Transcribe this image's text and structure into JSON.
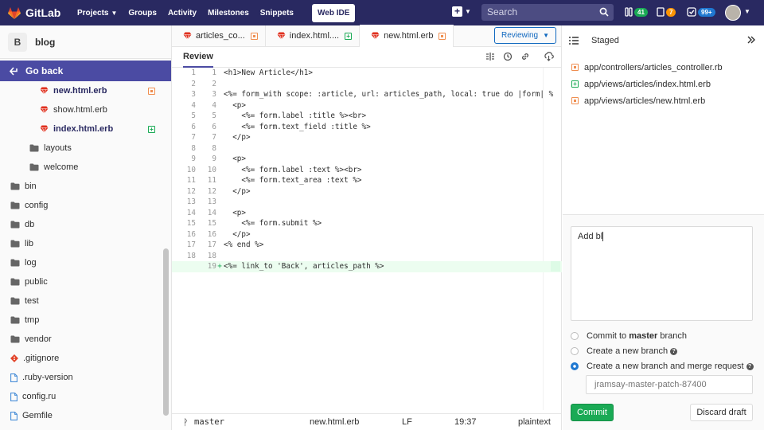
{
  "navbar": {
    "brand": "GitLab",
    "links": [
      {
        "label": "Projects",
        "dropdown": true
      },
      {
        "label": "Groups",
        "dropdown": false
      },
      {
        "label": "Activity",
        "dropdown": false
      },
      {
        "label": "Milestones",
        "dropdown": false
      },
      {
        "label": "Snippets",
        "dropdown": false
      }
    ],
    "web_ide": "Web IDE",
    "search_placeholder": "Search",
    "counters": {
      "merge_requests": "41",
      "issues": "7",
      "todos": "99+"
    },
    "colors": {
      "bg": "#292961",
      "mr_badge": "#1aaa55",
      "issue_badge": "#fc9403",
      "todo_badge": "#1f78d1"
    }
  },
  "sidebar": {
    "project_initial": "B",
    "project_name": "blog",
    "go_back": "Go back",
    "tree": [
      {
        "label": "new.html.erb",
        "type": "file-ruby",
        "indent": 3,
        "active": true,
        "status": "modified"
      },
      {
        "label": "show.html.erb",
        "type": "file-ruby",
        "indent": 3,
        "active": false,
        "status": ""
      },
      {
        "label": "index.html.erb",
        "type": "file-ruby",
        "indent": 3,
        "active": true,
        "status": "added"
      },
      {
        "label": "layouts",
        "type": "folder",
        "indent": 2,
        "active": false,
        "status": ""
      },
      {
        "label": "welcome",
        "type": "folder",
        "indent": 2,
        "active": false,
        "status": ""
      },
      {
        "label": "bin",
        "type": "folder",
        "indent": 0,
        "active": false,
        "status": ""
      },
      {
        "label": "config",
        "type": "folder",
        "indent": 0,
        "active": false,
        "status": ""
      },
      {
        "label": "db",
        "type": "folder",
        "indent": 0,
        "active": false,
        "status": ""
      },
      {
        "label": "lib",
        "type": "folder",
        "indent": 0,
        "active": false,
        "status": ""
      },
      {
        "label": "log",
        "type": "folder",
        "indent": 0,
        "active": false,
        "status": ""
      },
      {
        "label": "public",
        "type": "folder",
        "indent": 0,
        "active": false,
        "status": ""
      },
      {
        "label": "test",
        "type": "folder",
        "indent": 0,
        "active": false,
        "status": ""
      },
      {
        "label": "tmp",
        "type": "folder",
        "indent": 0,
        "active": false,
        "status": ""
      },
      {
        "label": "vendor",
        "type": "folder",
        "indent": 0,
        "active": false,
        "status": ""
      },
      {
        "label": ".gitignore",
        "type": "file-git",
        "indent": 0,
        "active": false,
        "status": ""
      },
      {
        "label": ".ruby-version",
        "type": "file",
        "indent": 0,
        "active": false,
        "status": ""
      },
      {
        "label": "config.ru",
        "type": "file",
        "indent": 0,
        "active": false,
        "status": ""
      },
      {
        "label": "Gemfile",
        "type": "file",
        "indent": 0,
        "active": false,
        "status": ""
      }
    ]
  },
  "editor": {
    "tabs": [
      {
        "label": "articles_co...",
        "status": "modified",
        "active": false
      },
      {
        "label": "index.html....",
        "status": "added",
        "active": false
      },
      {
        "label": "new.html.erb",
        "status": "modified",
        "active": true
      }
    ],
    "mode_button": "Reviewing",
    "subtab": "Review",
    "lines": [
      {
        "old": "1",
        "new": "1",
        "added": false,
        "text": "<h1>New Article</h1>"
      },
      {
        "old": "2",
        "new": "2",
        "added": false,
        "text": ""
      },
      {
        "old": "3",
        "new": "3",
        "added": false,
        "text": "<%= form_with scope: :article, url: articles_path, local: true do |form| %"
      },
      {
        "old": "4",
        "new": "4",
        "added": false,
        "text": "  <p>"
      },
      {
        "old": "5",
        "new": "5",
        "added": false,
        "text": "    <%= form.label :title %><br>"
      },
      {
        "old": "6",
        "new": "6",
        "added": false,
        "text": "    <%= form.text_field :title %>"
      },
      {
        "old": "7",
        "new": "7",
        "added": false,
        "text": "  </p>"
      },
      {
        "old": "8",
        "new": "8",
        "added": false,
        "text": ""
      },
      {
        "old": "9",
        "new": "9",
        "added": false,
        "text": "  <p>"
      },
      {
        "old": "10",
        "new": "10",
        "added": false,
        "text": "    <%= form.label :text %><br>"
      },
      {
        "old": "11",
        "new": "11",
        "added": false,
        "text": "    <%= form.text_area :text %>"
      },
      {
        "old": "12",
        "new": "12",
        "added": false,
        "text": "  </p>"
      },
      {
        "old": "13",
        "new": "13",
        "added": false,
        "text": ""
      },
      {
        "old": "14",
        "new": "14",
        "added": false,
        "text": "  <p>"
      },
      {
        "old": "15",
        "new": "15",
        "added": false,
        "text": "    <%= form.submit %>"
      },
      {
        "old": "16",
        "new": "16",
        "added": false,
        "text": "  </p>"
      },
      {
        "old": "17",
        "new": "17",
        "added": false,
        "text": "<% end %>"
      },
      {
        "old": "18",
        "new": "18",
        "added": false,
        "text": ""
      },
      {
        "old": "",
        "new": "19",
        "added": true,
        "text": "<%= link_to 'Back', articles_path %>"
      }
    ],
    "status": {
      "branch": "master",
      "file": "new.html.erb",
      "eol": "LF",
      "position": "19:37",
      "lang": "plaintext"
    }
  },
  "commit_panel": {
    "header": "Staged",
    "files": [
      {
        "path": "app/controllers/articles_controller.rb",
        "status": "modified"
      },
      {
        "path": "app/views/articles/index.html.erb",
        "status": "added"
      },
      {
        "path": "app/views/articles/new.html.erb",
        "status": "modified"
      }
    ],
    "message": "Add bl",
    "options": [
      {
        "prefix": "Commit to ",
        "bold": "master",
        "suffix": " branch",
        "checked": false,
        "help": false
      },
      {
        "prefix": "Create a new branch",
        "bold": "",
        "suffix": "",
        "checked": false,
        "help": true
      },
      {
        "prefix": "Create a new branch and merge request",
        "bold": "",
        "suffix": "",
        "checked": true,
        "help": true
      }
    ],
    "branch_placeholder": "jramsay-master-patch-87400",
    "commit_label": "Commit",
    "discard_label": "Discard draft"
  }
}
